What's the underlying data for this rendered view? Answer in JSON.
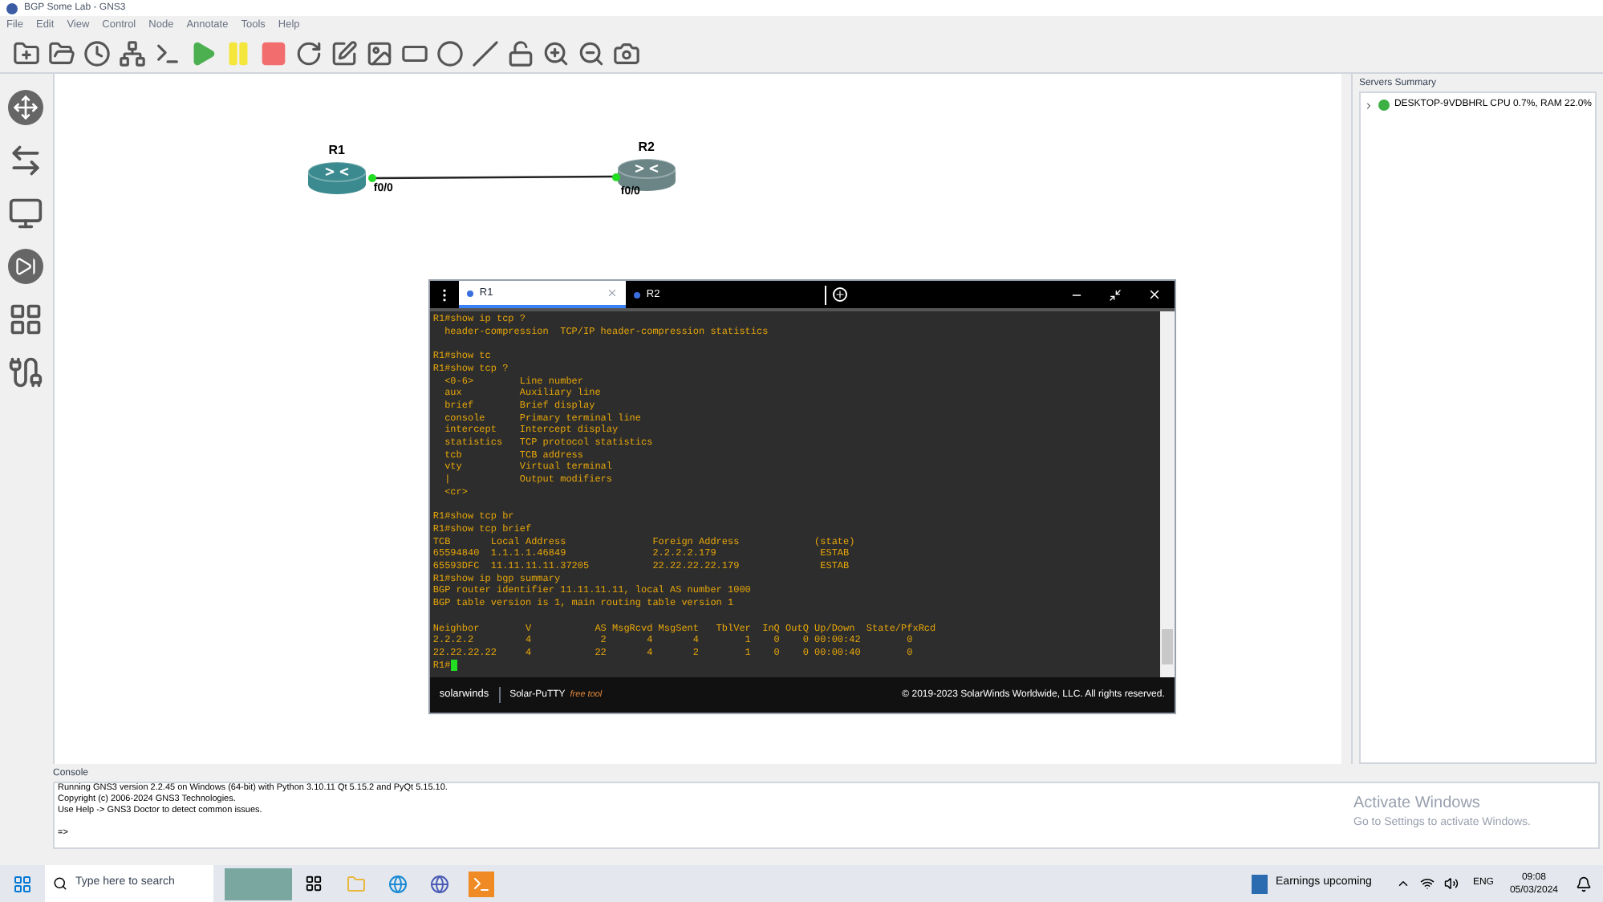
{
  "window": {
    "title": "BGP Some Lab - GNS3"
  },
  "menu": [
    "File",
    "Edit",
    "View",
    "Control",
    "Node",
    "Annotate",
    "Tools",
    "Help"
  ],
  "topology": {
    "nodes": [
      {
        "label": "R1",
        "port": "f0/0",
        "color": "#3a8a8f"
      },
      {
        "label": "R2",
        "port": "f0/0",
        "color": "#6b8587"
      }
    ]
  },
  "terminal": {
    "tabs": [
      {
        "label": "R1",
        "selected": true
      },
      {
        "label": "R2",
        "selected": false
      }
    ],
    "blocks": [
      [
        "R1#show ip tcp ?",
        "  header-compression  TCP/IP header-compression statistics"
      ],
      [
        "R1#show tc",
        "R1#show tcp ?",
        "  <0-6>        Line number",
        "  aux          Auxiliary line",
        "  brief        Brief display",
        "  console      Primary terminal line",
        "  intercept    Intercept display",
        "  statistics   TCP protocol statistics",
        "  tcb          TCB address",
        "  vty          Virtual terminal",
        "  |            Output modifiers",
        "  <cr>"
      ],
      [
        "R1#show tcp br",
        "R1#show tcp brief",
        "TCB       Local Address               Foreign Address             (state)",
        "65594840  1.1.1.1.46849               2.2.2.2.179                  ESTAB",
        "65593DFC  11.11.11.11.37205           22.22.22.22.179              ESTAB",
        "R1#show ip bgp summary",
        "BGP router identifier 11.11.11.11, local AS number 1000",
        "BGP table version is 1, main routing table version 1"
      ],
      [
        "Neighbor        V           AS MsgRcvd MsgSent   TblVer  InQ OutQ Up/Down  State/PfxRcd",
        "2.2.2.2         4            2       4       4        1    0    0 00:00:42        0",
        "22.22.22.22     4           22       4       2        1    0    0 00:00:40        0"
      ]
    ],
    "prompt": "R1#",
    "brand": "solarwinds",
    "product": "Solar-PuTTY",
    "product_note": "free tool",
    "copyright": "© 2019-2023 SolarWinds Worldwide, LLC. All rights reserved."
  },
  "servers_summary": {
    "title": "Servers Summary",
    "servers": [
      {
        "name": "DESKTOP-9VDBHRL CPU 0.7%, RAM 22.0%",
        "color": "#3cb043"
      }
    ]
  },
  "console": {
    "title": "Console",
    "lines": [
      "Running GNS3 version 2.2.45 on Windows (64-bit) with Python 3.10.11 Qt 5.15.2 and PyQt 5.15.10.",
      "Copyright (c) 2006-2024 GNS3 Technologies.",
      "Use Help -> GNS3 Doctor to detect common issues."
    ],
    "prompt": "=>"
  },
  "watermark": {
    "title": "Activate Windows",
    "subtitle": "Go to Settings to activate Windows."
  },
  "taskbar": {
    "search_placeholder": "Type here to search",
    "news": "Earnings upcoming",
    "language": "ENG",
    "time": "09:08",
    "date": "05/03/2024"
  }
}
